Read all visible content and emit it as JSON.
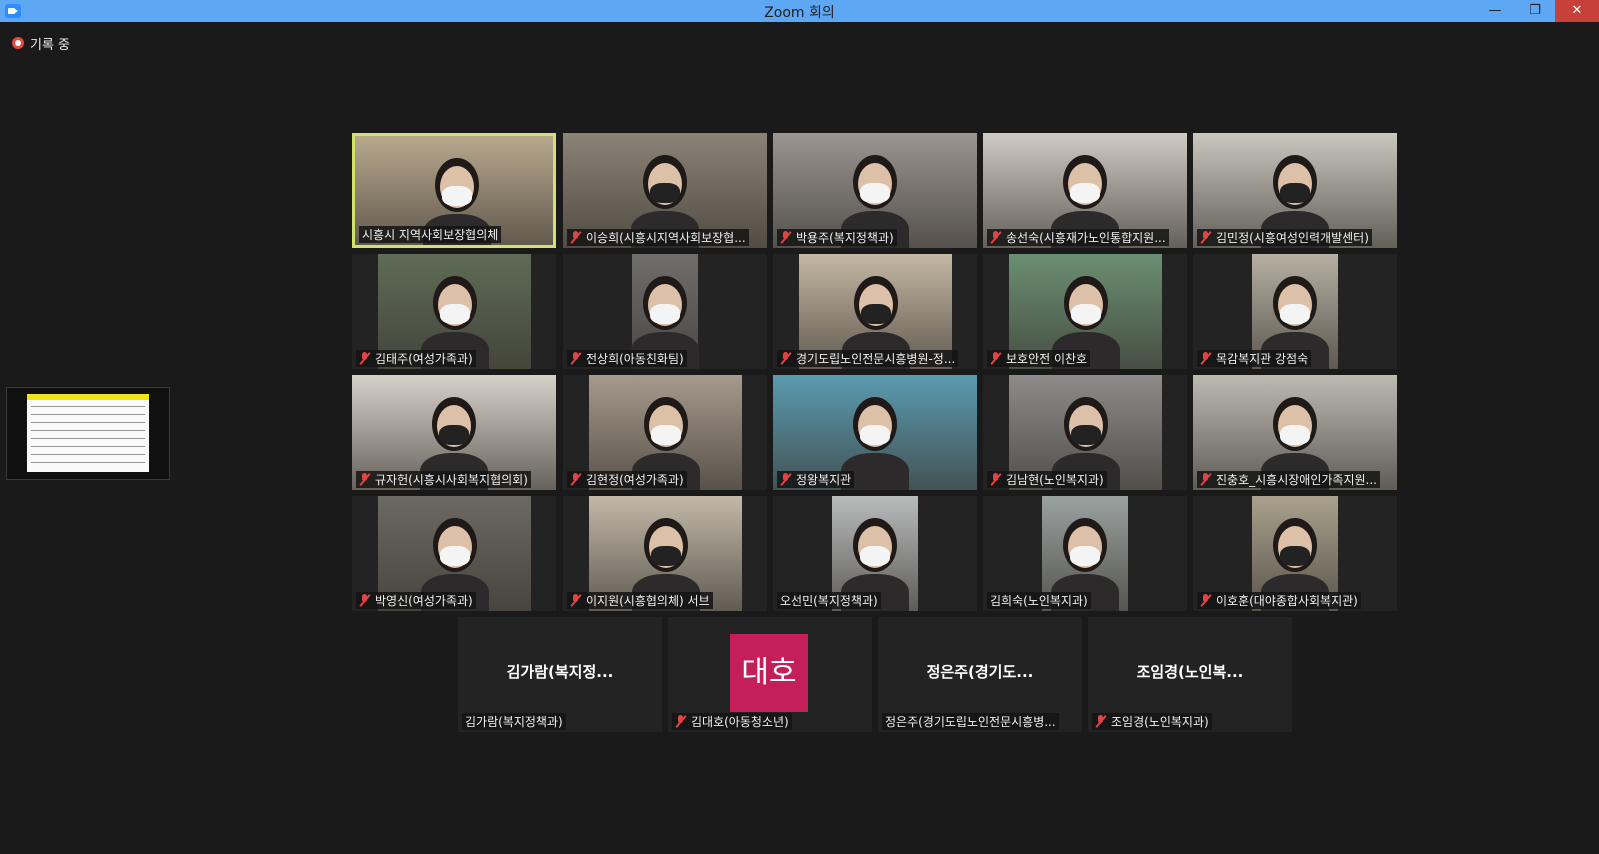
{
  "window": {
    "title": "Zoom 회의",
    "min_label": "—",
    "max_label": "❐",
    "close_label": "✕"
  },
  "recording": {
    "label": "기록 중"
  },
  "participants": [
    {
      "name": "시흥시 지역사회보장협의체",
      "muted": false,
      "active": true,
      "bg": "#b8a88e"
    },
    {
      "name": "이승희(시흥시지역사회보장협...",
      "muted": true,
      "bg": "#8b8376"
    },
    {
      "name": "박용주(복지정책과)",
      "muted": true,
      "bg": "#9a9590"
    },
    {
      "name": "송선숙(시흥재가노인통합지원...",
      "muted": true,
      "bg": "#cfcac3"
    },
    {
      "name": "김민정(시흥여성인력개발센터)",
      "muted": true,
      "bg": "#c9c7be"
    },
    {
      "name": "김태주(여성가족과)",
      "muted": true,
      "bg": "#5e6c56"
    },
    {
      "name": "전상희(아동친화팀)",
      "muted": true,
      "bg": "#706e6c"
    },
    {
      "name": "경기도립노인전문시흥병원-정...",
      "muted": true,
      "bg": "#c4b8a3"
    },
    {
      "name": "보호안전 이찬호",
      "muted": true,
      "bg": "#6a8f72"
    },
    {
      "name": "목감복지관 강점숙",
      "muted": true,
      "bg": "#b5b0a2"
    },
    {
      "name": "규자헌(시흥시사회복지협의회)",
      "muted": true,
      "bg": "#d6d1c8"
    },
    {
      "name": "김현정(여성가족과)",
      "muted": true,
      "bg": "#a59a8c"
    },
    {
      "name": "정왕복지관",
      "muted": true,
      "bg": "#5a9bb0"
    },
    {
      "name": "김남현(노인복지과)",
      "muted": true,
      "bg": "#8d8c8a"
    },
    {
      "name": "진충호_시흥시장애인가족지원...",
      "muted": true,
      "bg": "#bdbab4"
    },
    {
      "name": "박영신(여성가족과)",
      "muted": true,
      "bg": "#6b6a62"
    },
    {
      "name": "이지원(시흥협의체) 서브",
      "muted": true,
      "bg": "#c2b9a8"
    },
    {
      "name": "오선민(복지정책과)",
      "muted": false,
      "bg": "#b9bcbc"
    },
    {
      "name": "김희숙(노인복지과)",
      "muted": false,
      "bg": "#9aa2a0"
    },
    {
      "name": "이호훈(대야종합사회복지관)",
      "muted": true,
      "bg": "#aaa28e"
    }
  ],
  "no_video": [
    {
      "display": "김가람(복지정...",
      "name": "김가람(복지정책과)",
      "muted": false
    },
    {
      "avatar": "대호",
      "name": "김대호(아동청소년)",
      "muted": true
    },
    {
      "display": "정은주(경기도...",
      "name": "정은주(경기도립노인전문시흥병...",
      "muted": false
    },
    {
      "display": "조임경(노인복...",
      "name": "조임경(노인복지과)",
      "muted": true
    }
  ]
}
